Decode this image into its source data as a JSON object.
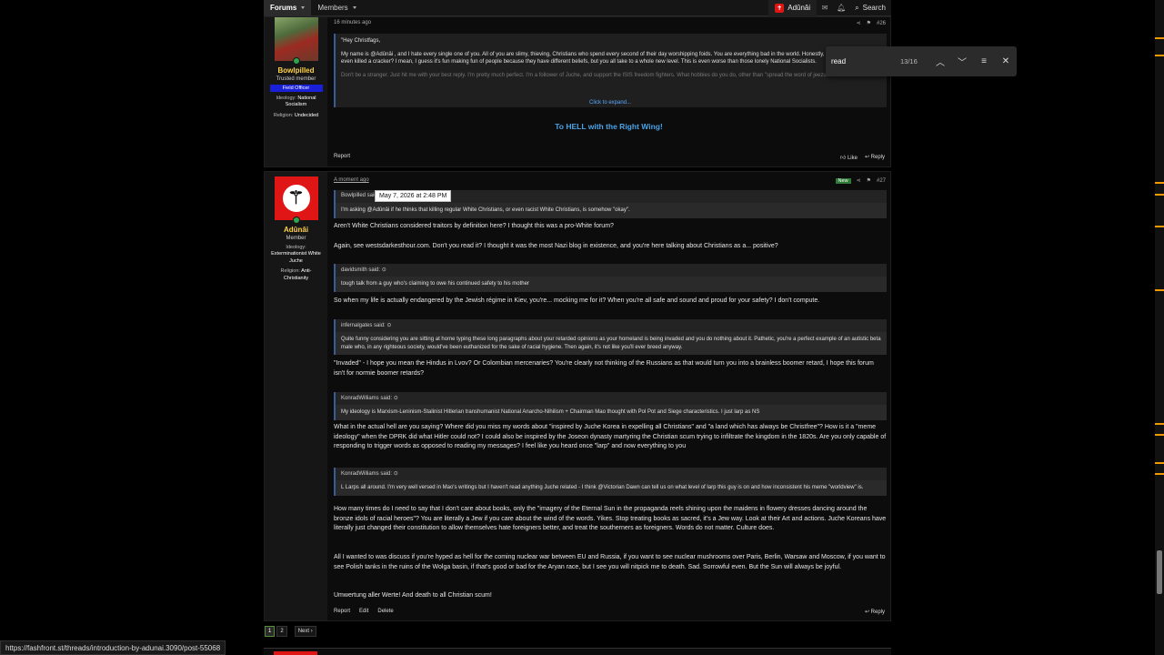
{
  "nav": {
    "tabs": [
      {
        "label": "Forums"
      },
      {
        "label": "Members"
      }
    ],
    "user": "Adûnâi",
    "search_label": "Search"
  },
  "post1": {
    "time": "16 minutes ago",
    "number": "#26",
    "user": {
      "name": "Bowlpilled",
      "title": "Trusted member",
      "banner": "Field Officer",
      "ideology_label": "Ideology:",
      "ideology": "National Socialism",
      "religion_label": "Religion:",
      "religion": "Undecided"
    },
    "quote": {
      "line1": "\"Hey Christfags,",
      "line2": "My name is @Adûnâi , and I hate every single one of you. All of you are slimy, thieving, Christians who spend every second of their day worshipping foids. You are everything bad in the world. Honestly, have any of you ever even killed a cracker? I mean, I guess it's fun making fun of people because they have different beliefs, but you all take to a whole new level. This is even worse than those lonely National Socialists.",
      "line3": "Don't be a stranger. Just hit me with your best reply. I'm pretty much perfect. I'm a follower of Juche, and support the ISIS freedom fighters. What hobbies do you do, other than \"spread the word of jeezus\"?",
      "expand": "Click to expand..."
    },
    "center": "To HELL with the Right Wing!",
    "report": "Report",
    "like": "Like",
    "reply": "Reply"
  },
  "post2": {
    "time": "A moment ago",
    "tooltip": "May 7, 2026 at 2:48 PM",
    "badge": "New",
    "number": "#27",
    "user": {
      "name": "Adûnâi",
      "title": "Member",
      "ideology_label": "Ideology:",
      "ideology": "Exterminationist White Juche",
      "religion_label": "Religion:",
      "religion": "Anti-Christianity"
    },
    "q1_head": "Bowlpilled said:",
    "q1_text": "I'm asking @Adûnâi if he thinks that killing regular White Christians, or even racist White Christians, is somehow \"okay\".",
    "p1": "Aren't White Christians considered traitors by definition here? I thought this was a pro-White forum?",
    "p2": "Again, see westsdarkesthour.com. Don't you read it? I thought it was the most Nazi blog in existence, and you're here talking about Christians as a... positive?",
    "q2_head": "davidsmith said:",
    "q2_text": "tough talk from a guy who's claiming to owe his continued safety to his mother",
    "p3": "So when my life is actually endangered by the Jewish régime in Kiev, you're... mocking me for it? When you're all safe and sound and proud for your safety? I don't compute.",
    "q3_head": "infernalgates said:",
    "q3_text": "Quite funny considering you are sitting at home typing these long paragraphs about your retarded opinions as your homeland is being invaded and you do nothing about it. Pathetic, you're a perfect example of an autistic beta male who, in any righteous society, would've been euthanized for the sake of racial hygiene. Then again, it's not like you'll ever breed anyway.",
    "p4": "\"Invaded\" - I hope you mean the Hindus in Lvov? Or Colombian mercenaries? You're clearly not thinking of the Russians as that would turn you into a brainless boomer retard, I hope this forum isn't for normie boomer retards?",
    "q4_head": "KonradWilliams said:",
    "q4_text": "My ideology is Marxism-Leninism-Stalinist Hitlerian transhumanist National Anarcho-Nihilism + Chairman Mao thought with Pol Pot and Siege characteristics. I just larp as NS",
    "p5": "What in the actual hell are you saying? Where did you miss my words about \"inspired by Juche Korea in expelling all Christians\" and \"a land which has always be Christfree\"? How is it a \"meme ideology\" when the DPRK did what Hitler could not? I could also be inspired by the Joseon dynasty martyring the Christian scum trying to infiltrate the kingdom in the 1820s. Are you only capable of responding to trigger words as opposed to reading my messages? I feel like you heard once \"larp\" and now everything to you",
    "q5_head": "KonradWilliams said:",
    "q5_text": "L Larps all around. I'm very well versed in Mao's writings but I haven't read anything Juche related - I think @Victorian Dawn can tell us on what level of larp this guy is on and how inconsistent his meme \"worldview\" is.",
    "p6": "How many times do I need to say that I don't care about books, only the \"imagery of the Eternal Sun in the propaganda reels shining upon the maidens in flowery dresses dancing around the bronze idols of racial heroes\"? You are literally a Jew if you care about the wind of the words. Yikes. Stop treating books as sacred, it's a Jew way. Look at their Art and actions. Juche Koreans have literally just changed their constitution to allow themselves hate foreigners better, and treat the southerners as foreigners. Words do not matter. Culture does.",
    "p7": "All I wanted to was discuss if you're hyped as hell for the coming nuclear war between EU and Russia, if you want to see nuclear mushrooms over Paris, Berlin, Warsaw and Moscow, if you want to see Polish tanks in the ruins of the Wolga basin, if that's good or bad for the Aryan race, but I see you will nitpick me to death. Sad. Sorrowful even. But the Sun will always be joyful.",
    "p8": "Umwertung aller Werte! And death to all Christian scum!",
    "report": "Report",
    "edit": "Edit",
    "delete": "Delete",
    "reply": "Reply"
  },
  "find": {
    "query": "read",
    "count": "13/16"
  },
  "pager": {
    "p1": "1",
    "p2": "2",
    "next": "Next ›"
  },
  "status_url": "https://fashfront.st/threads/introduction-by-adunai.3090/post-55068"
}
